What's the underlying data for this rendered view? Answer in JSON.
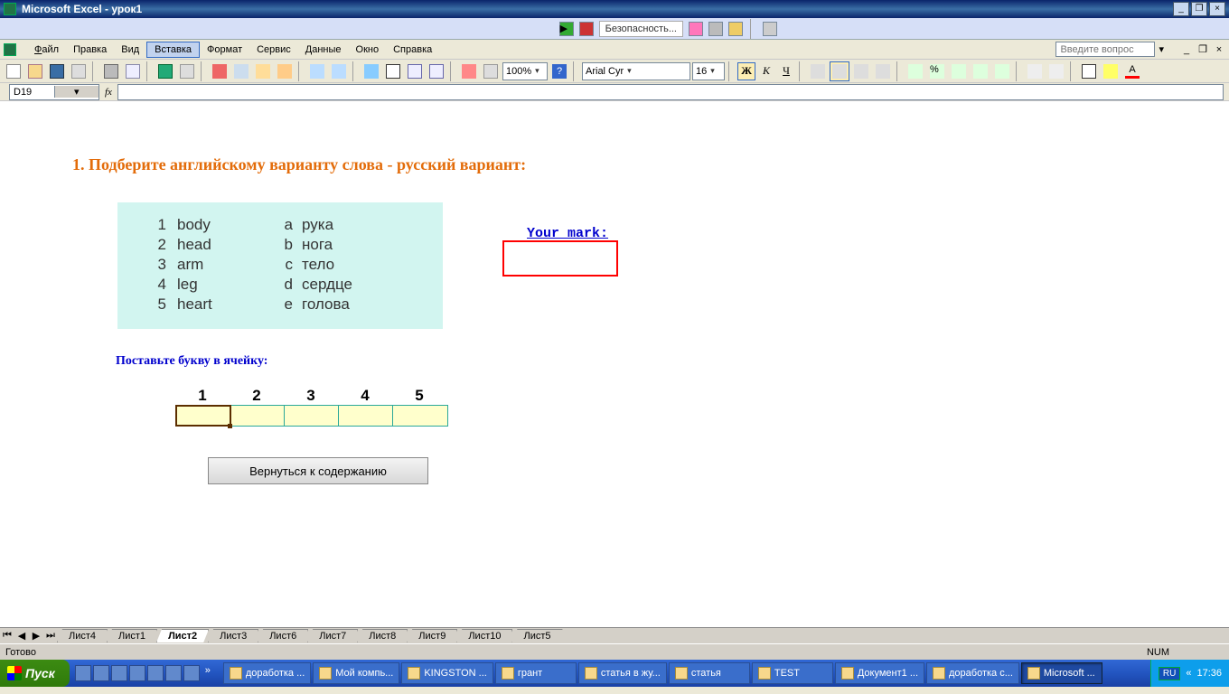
{
  "titlebar": {
    "title": "Microsoft Excel - урок1"
  },
  "secbar": {
    "label": "Безопасность..."
  },
  "menus": {
    "file": "Файл",
    "edit": "Правка",
    "view": "Вид",
    "insert": "Вставка",
    "format": "Формат",
    "tools": "Сервис",
    "data": "Данные",
    "window": "Окно",
    "help": "Справка",
    "question_placeholder": "Введите вопрос"
  },
  "toolbar": {
    "zoom": "100%",
    "font_name": "Arial Cyr",
    "font_size": "16",
    "bold": "Ж",
    "italic": "К",
    "underline": "Ч"
  },
  "formula": {
    "cellref": "D19"
  },
  "content": {
    "heading": "1. Подберите английскому варианту слова - русский вариант:",
    "vocab": [
      {
        "n": "1",
        "en": "body",
        "l": "a",
        "ru": "рука"
      },
      {
        "n": "2",
        "en": "head",
        "l": "b",
        "ru": "нога"
      },
      {
        "n": "3",
        "en": "arm",
        "l": "c",
        "ru": "тело"
      },
      {
        "n": "4",
        "en": "leg",
        "l": "d",
        "ru": "сердце"
      },
      {
        "n": "5",
        "en": "heart",
        "l": "e",
        "ru": "голова"
      }
    ],
    "mark_label": "Your mark:",
    "instruction": "Поставьте букву в ячейку:",
    "answer_numbers": [
      "1",
      "2",
      "3",
      "4",
      "5"
    ],
    "back_button": "Вернуться к содержанию"
  },
  "sheets": [
    "Лист4",
    "Лист1",
    "Лист2",
    "Лист3",
    "Лист6",
    "Лист7",
    "Лист8",
    "Лист9",
    "Лист10",
    "Лист5"
  ],
  "active_sheet": "Лист2",
  "statusbar": {
    "ready": "Готово",
    "num": "NUM"
  },
  "taskbar": {
    "start": "Пуск",
    "tasks": [
      "доработка ...",
      "Мой компь...",
      "KINGSTON ...",
      "грант",
      "статья в жу...",
      "статья",
      "TEST",
      "Документ1 ...",
      "доработка с...",
      "Microsoft ..."
    ],
    "active_task": "Microsoft ...",
    "lang": "RU",
    "clock": "17:36",
    "chev": "«"
  }
}
